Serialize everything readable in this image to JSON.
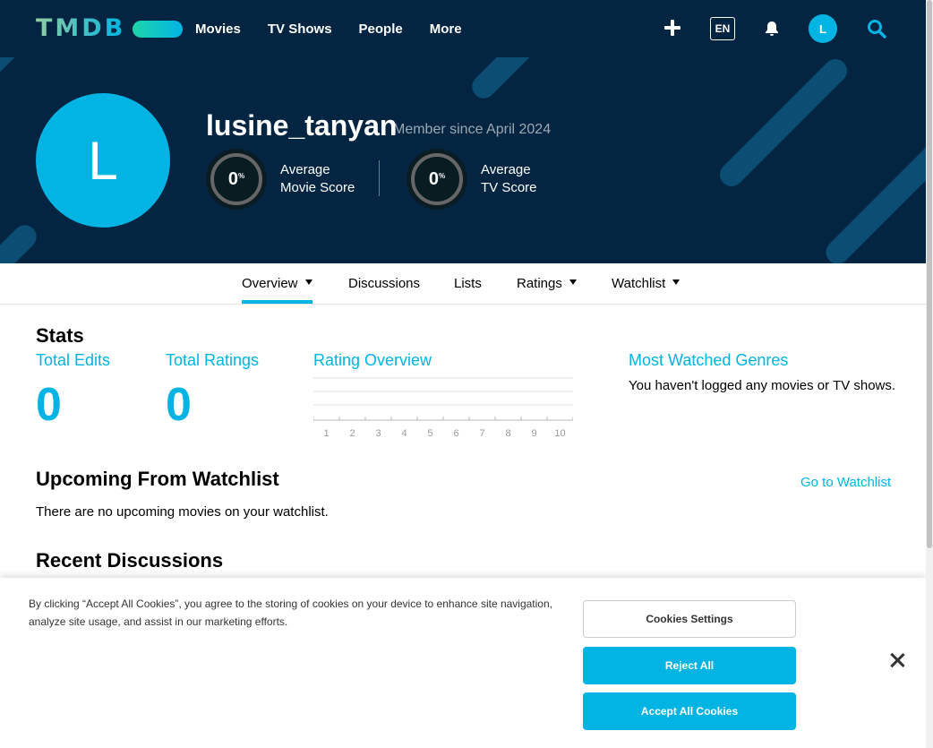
{
  "nav": {
    "logo": "TMDB",
    "links": [
      "Movies",
      "TV Shows",
      "People",
      "More"
    ],
    "lang": "EN",
    "avatar_letter": "L"
  },
  "profile": {
    "avatar_letter": "L",
    "username": "lusine_tanyan",
    "member_since": "Member since April 2024",
    "movie_score": {
      "value": "0",
      "unit": "%",
      "label_line1": "Average",
      "label_line2": "Movie Score"
    },
    "tv_score": {
      "value": "0",
      "unit": "%",
      "label_line1": "Average",
      "label_line2": "TV Score"
    }
  },
  "subnav": {
    "overview": "Overview",
    "discussions": "Discussions",
    "lists": "Lists",
    "ratings": "Ratings",
    "watchlist": "Watchlist"
  },
  "stats": {
    "heading": "Stats",
    "total_edits_label": "Total Edits",
    "total_edits_value": "0",
    "total_ratings_label": "Total Ratings",
    "total_ratings_value": "0",
    "rating_overview_title": "Rating Overview",
    "rating_ticks": [
      "1",
      "2",
      "3",
      "4",
      "5",
      "6",
      "7",
      "8",
      "9",
      "10"
    ],
    "genres_title": "Most Watched Genres",
    "genres_text": "You haven't logged any movies or TV shows."
  },
  "upcoming": {
    "heading": "Upcoming From Watchlist",
    "link": "Go to Watchlist",
    "text": "There are no upcoming movies on your watchlist."
  },
  "discussions": {
    "heading": "Recent Discussions"
  },
  "cookie": {
    "text": "By clicking “Accept All Cookies”, you agree to the storing of cookies on your device to enhance site navigation, analyze site usage, and assist in our marketing efforts.",
    "settings": "Cookies Settings",
    "reject": "Reject All",
    "accept": "Accept All Cookies"
  },
  "colors": {
    "navy": "#032541",
    "accent": "#01b4e4"
  }
}
